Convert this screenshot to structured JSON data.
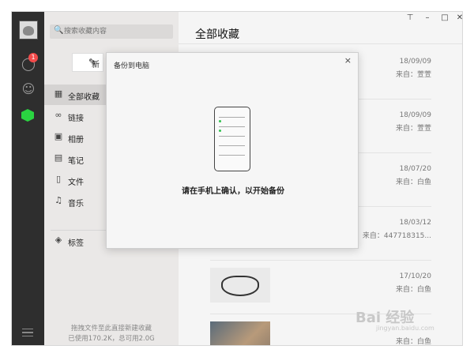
{
  "sidebar": {
    "search_placeholder": "搜索收藏内容",
    "new_button_label": "新",
    "notification_count": "1",
    "items": [
      {
        "icon": "grid-icon",
        "label": "全部收藏"
      },
      {
        "icon": "link-icon",
        "label": "链接"
      },
      {
        "icon": "image-icon",
        "label": "相册"
      },
      {
        "icon": "note-icon",
        "label": "笔记"
      },
      {
        "icon": "file-icon",
        "label": "文件"
      },
      {
        "icon": "music-icon",
        "label": "音乐"
      }
    ],
    "tags_label": "标签",
    "footer_line1": "拖拽文件至此直接新建收藏",
    "footer_line2": "已使用170.2K，总可用2.0G"
  },
  "main": {
    "title": "全部收藏",
    "items": [
      {
        "date": "18/09/09",
        "source": "来自：萱萱"
      },
      {
        "date": "18/09/09",
        "source": "来自：萱萱"
      },
      {
        "date": "18/07/20",
        "source": "来自：白鱼"
      },
      {
        "date": "18/03/12",
        "source": "来自：447718315..."
      },
      {
        "date": "17/10/20",
        "source": "来自：白鱼"
      },
      {
        "date": "",
        "source": "来自：白鱼"
      }
    ]
  },
  "dialog": {
    "title": "备份到电脑",
    "message": "请在手机上确认，以开始备份"
  },
  "watermark": {
    "text": "Bai 经验",
    "sub": "jingyan.baidu.com"
  },
  "colors": {
    "accent_green": "#2ad441",
    "badge_red": "#f34b4b",
    "leftbar": "#2e2e2e"
  }
}
